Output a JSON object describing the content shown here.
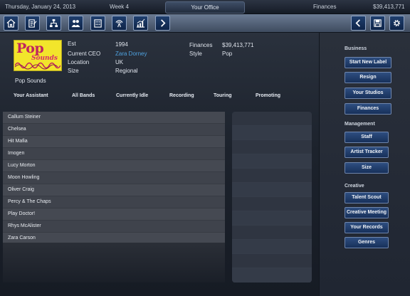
{
  "status_bar": {
    "date": "Thursday, January 24, 2013",
    "week": "Week 4",
    "section": "Your Office",
    "finance_label": "Finances",
    "finance_value": "$39,413,771"
  },
  "toolbar": {
    "left_icons": [
      "home-icon",
      "contract-icon",
      "network-icon",
      "people-icon",
      "building-icon",
      "broadcast-icon",
      "chart-icon",
      "forward-arrow-icon"
    ],
    "right_icons": [
      "back-arrow-icon",
      "save-icon",
      "gear-icon"
    ]
  },
  "company": {
    "logo_text_1": "Pop",
    "logo_text_2": "Sounds",
    "name": "Pop Sounds",
    "est_label": "Est",
    "est_value": "1994",
    "ceo_label": "Current CEO",
    "ceo_value": "Zara Dorney",
    "location_label": "Location",
    "location_value": "UK",
    "size_label": "Size",
    "size_value": "Regional",
    "finances_label": "Finances",
    "finances_value": "$39,413,771",
    "style_label": "Style",
    "style_value": "Pop"
  },
  "tabs": [
    "Your Assistant",
    "All Bands",
    "Currently Idle",
    "Recording",
    "Touring",
    "Promoting"
  ],
  "bands": [
    "Callum Steiner",
    "Chelsea",
    "Hit Mafia",
    "Imogen",
    "Lucy Morton",
    "Moon Howling",
    "Oliver Craig",
    "Percy & The Chaps",
    "Play Doctor!",
    "Rhys McAlister",
    "Zara Carson"
  ],
  "side_menu": {
    "business_heading": "Business",
    "business": [
      "Start New Label",
      "Resign",
      "Your Studios",
      "Finances"
    ],
    "management_heading": "Management",
    "management": [
      "Staff",
      "Artist Tracker",
      "Size"
    ],
    "creative_heading": "Creative",
    "creative": [
      "Talent Scout",
      "Creative Meeting",
      "Your Records",
      "Genres"
    ]
  },
  "colors": {
    "ceo_link": "#4fa3e0",
    "logo_yellow": "#f2e52b",
    "logo_pink": "#c0245f",
    "button_blue": "#1f3f6e"
  }
}
